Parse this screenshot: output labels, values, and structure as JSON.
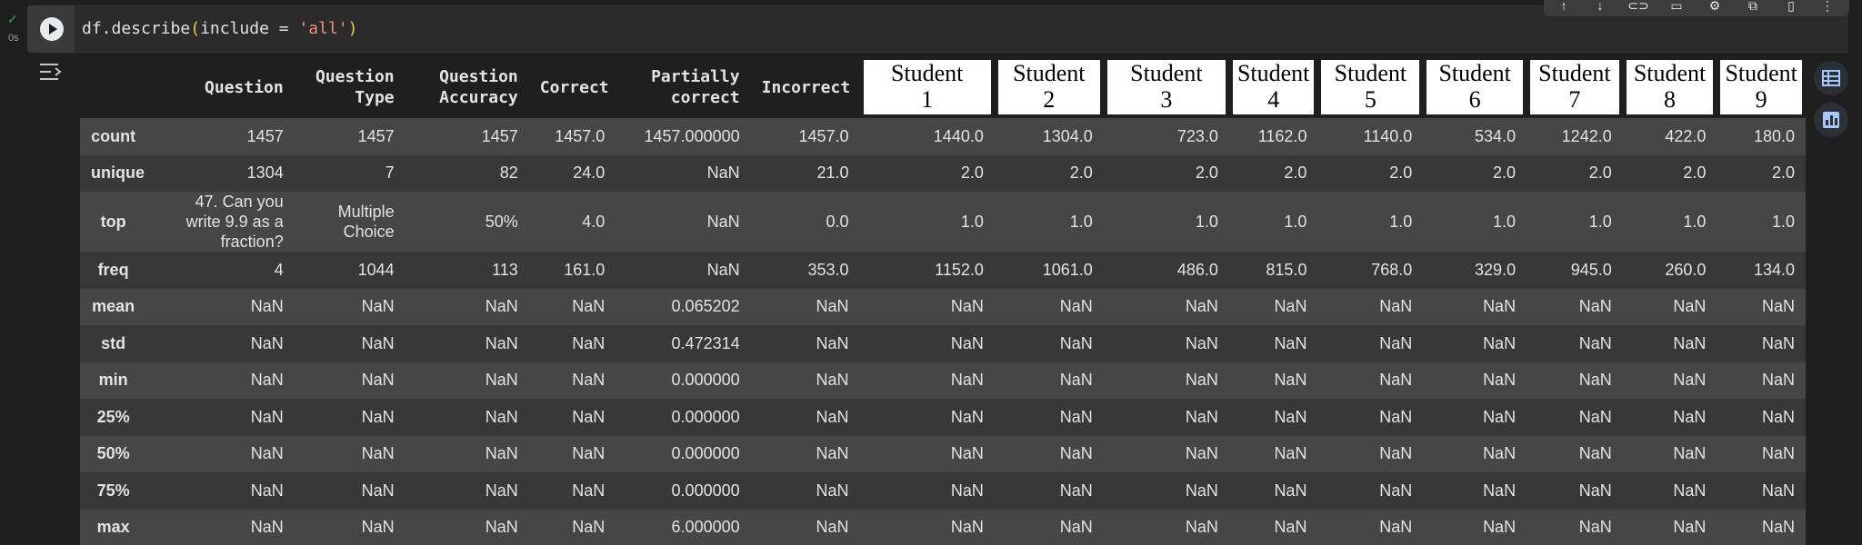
{
  "cell": {
    "status_time": "0s",
    "code": {
      "prefix": "df.describe",
      "open_paren": "(",
      "arg": "include = ",
      "string": "'all'",
      "close_paren": ")"
    }
  },
  "toolbar": {
    "icons": [
      "move-up-icon",
      "move-down-icon",
      "link-icon",
      "comment-icon",
      "settings-icon",
      "open-in-tab-icon",
      "delete-icon",
      "more-icon"
    ]
  },
  "table": {
    "columns": [
      "Question",
      "Question Type",
      "Question Accuracy",
      "Correct",
      "Partially correct",
      "Incorrect"
    ],
    "student_columns": [
      {
        "word": "Student",
        "num": "1"
      },
      {
        "word": "Student",
        "num": "2"
      },
      {
        "word": "Student",
        "num": "3"
      },
      {
        "word": "Student",
        "num": "4"
      },
      {
        "word": "Student",
        "num": "5"
      },
      {
        "word": "Student",
        "num": "6"
      },
      {
        "word": "Student",
        "num": "7"
      },
      {
        "word": "Student",
        "num": "8"
      },
      {
        "word": "Student",
        "num": "9"
      }
    ],
    "rows": [
      {
        "label": "count",
        "cells": [
          "1457",
          "1457",
          "1457",
          "1457.0",
          "1457.000000",
          "1457.0",
          "1440.0",
          "1304.0",
          "723.0",
          "1162.0",
          "1140.0",
          "534.0",
          "1242.0",
          "422.0",
          "180.0"
        ]
      },
      {
        "label": "unique",
        "cells": [
          "1304",
          "7",
          "82",
          "24.0",
          "NaN",
          "21.0",
          "2.0",
          "2.0",
          "2.0",
          "2.0",
          "2.0",
          "2.0",
          "2.0",
          "2.0",
          "2.0"
        ]
      },
      {
        "label": "top",
        "cells": [
          "47. Can you write 9.9 as a fraction?",
          "Multiple Choice",
          "50%",
          "4.0",
          "NaN",
          "0.0",
          "1.0",
          "1.0",
          "1.0",
          "1.0",
          "1.0",
          "1.0",
          "1.0",
          "1.0",
          "1.0"
        ]
      },
      {
        "label": "freq",
        "cells": [
          "4",
          "1044",
          "113",
          "161.0",
          "NaN",
          "353.0",
          "1152.0",
          "1061.0",
          "486.0",
          "815.0",
          "768.0",
          "329.0",
          "945.0",
          "260.0",
          "134.0"
        ]
      },
      {
        "label": "mean",
        "cells": [
          "NaN",
          "NaN",
          "NaN",
          "NaN",
          "0.065202",
          "NaN",
          "NaN",
          "NaN",
          "NaN",
          "NaN",
          "NaN",
          "NaN",
          "NaN",
          "NaN",
          "NaN"
        ]
      },
      {
        "label": "std",
        "cells": [
          "NaN",
          "NaN",
          "NaN",
          "NaN",
          "0.472314",
          "NaN",
          "NaN",
          "NaN",
          "NaN",
          "NaN",
          "NaN",
          "NaN",
          "NaN",
          "NaN",
          "NaN"
        ]
      },
      {
        "label": "min",
        "cells": [
          "NaN",
          "NaN",
          "NaN",
          "NaN",
          "0.000000",
          "NaN",
          "NaN",
          "NaN",
          "NaN",
          "NaN",
          "NaN",
          "NaN",
          "NaN",
          "NaN",
          "NaN"
        ]
      },
      {
        "label": "25%",
        "cells": [
          "NaN",
          "NaN",
          "NaN",
          "NaN",
          "0.000000",
          "NaN",
          "NaN",
          "NaN",
          "NaN",
          "NaN",
          "NaN",
          "NaN",
          "NaN",
          "NaN",
          "NaN"
        ]
      },
      {
        "label": "50%",
        "cells": [
          "NaN",
          "NaN",
          "NaN",
          "NaN",
          "0.000000",
          "NaN",
          "NaN",
          "NaN",
          "NaN",
          "NaN",
          "NaN",
          "NaN",
          "NaN",
          "NaN",
          "NaN"
        ]
      },
      {
        "label": "75%",
        "cells": [
          "NaN",
          "NaN",
          "NaN",
          "NaN",
          "0.000000",
          "NaN",
          "NaN",
          "NaN",
          "NaN",
          "NaN",
          "NaN",
          "NaN",
          "NaN",
          "NaN",
          "NaN"
        ]
      },
      {
        "label": "max",
        "cells": [
          "NaN",
          "NaN",
          "NaN",
          "NaN",
          "6.000000",
          "NaN",
          "NaN",
          "NaN",
          "NaN",
          "NaN",
          "NaN",
          "NaN",
          "NaN",
          "NaN",
          "NaN"
        ]
      }
    ]
  },
  "colors": {
    "background": "#1f1f1f",
    "row_odd": "#464646",
    "row_even": "#383838",
    "run_check": "#34a853",
    "string": "#f28b82",
    "paren": "#f2c94c"
  }
}
